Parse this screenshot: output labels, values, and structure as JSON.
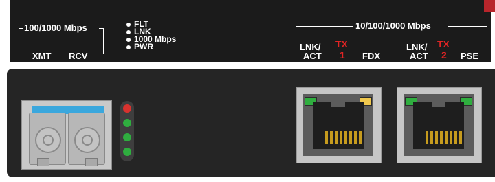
{
  "sfp_group": {
    "speed": "100/1000 Mbps",
    "xmt_label": "XMT",
    "rcv_label": "RCV"
  },
  "led_legend": [
    "FLT",
    "LNK",
    "1000 Mbps",
    "PWR"
  ],
  "rj45_group": {
    "speed": "10/100/1000 Mbps",
    "port1": {
      "lnk": "LNK/",
      "act": "ACT",
      "tx": "TX",
      "num": "1",
      "fdx": "FDX"
    },
    "port2": {
      "lnk": "LNK/",
      "act": "ACT",
      "tx": "TX",
      "num": "2",
      "pse": "PSE"
    }
  },
  "colors": {
    "panel": "#1b1b1b",
    "device": "#252525",
    "sfp_blue": "#3aa7dd",
    "led_red": "#d8322e",
    "led_green": "#2fae3f",
    "led_amber": "#f0c84e",
    "tx_red": "#e02424"
  },
  "status_leds": [
    "red",
    "green",
    "green",
    "green"
  ],
  "port_leds": {
    "port1": [
      "green",
      "amber"
    ],
    "port2": [
      "green",
      "green"
    ]
  }
}
